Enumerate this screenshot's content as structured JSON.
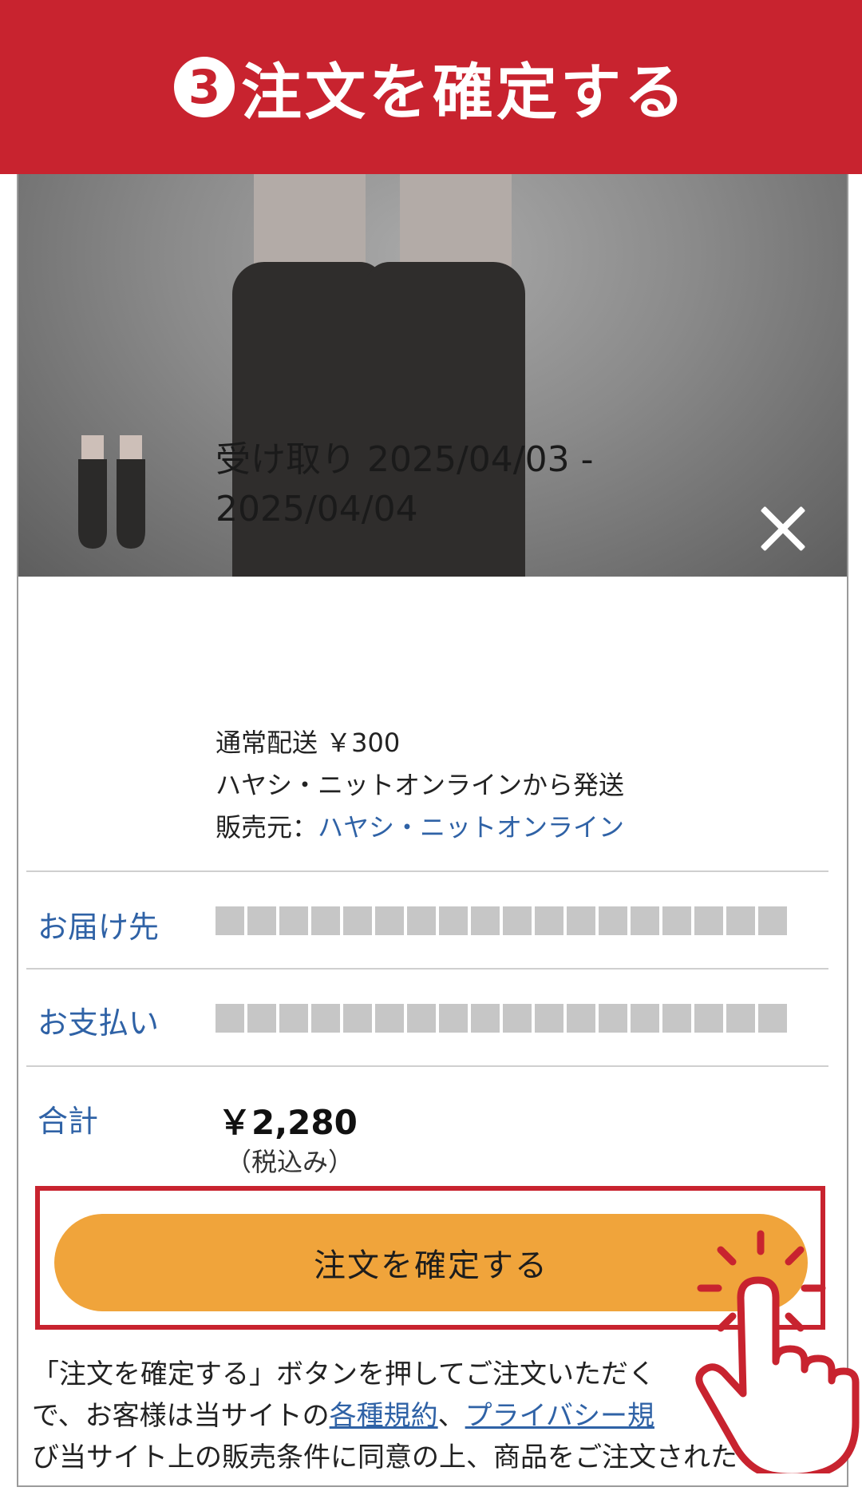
{
  "header": {
    "step_number": "3",
    "title": "注文を確定する"
  },
  "colors": {
    "header_red": "#c8232f",
    "button_orange": "#f0a43b",
    "link_blue": "#2f62a6"
  },
  "hero": {
    "close_icon": "close-icon"
  },
  "item": {
    "delivery_line1": "受け取り 2025/04/03 -",
    "delivery_line2": "2025/04/04",
    "shipping": "通常配送 ￥300",
    "ships_from": "ハヤシ・ニットオンラインから発送",
    "seller_label": "販売元：",
    "seller_name": "ハヤシ・ニットオンライン"
  },
  "rows": {
    "address_label": "お届け先",
    "payment_label": "お支払い",
    "total_label": "合計",
    "total_amount": "￥2,280",
    "tax_note": "（税込み）"
  },
  "confirm_button_label": "注文を確定する",
  "legal": {
    "line1": "「注文を確定する」ボタンを押してご注文いただく",
    "line2_a": "で、お客様は当サイトの",
    "terms_link": "各種規約",
    "sep": "、",
    "privacy_link": "プライバシー規",
    "line3": "び当サイト上の販売条件に同意の上、商品をご注文された"
  }
}
